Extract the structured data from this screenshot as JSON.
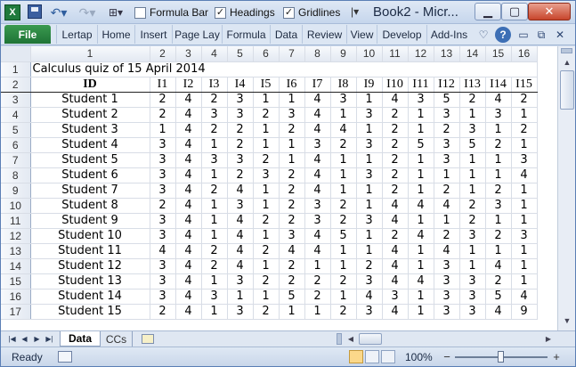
{
  "titlebar": {
    "app_icon": "excel-icon",
    "formula_bar_label": "Formula Bar",
    "formula_bar_checked": false,
    "headings_label": "Headings",
    "headings_checked": true,
    "gridlines_label": "Gridlines",
    "gridlines_checked": true,
    "document_title": "Book2 - Micr...",
    "icons": [
      "save-icon",
      "undo-icon",
      "redo-icon",
      "customize-icon",
      "minimize-icon",
      "maximize-icon",
      "close-icon"
    ]
  },
  "ribbon": {
    "file_label": "File",
    "tabs": [
      "Lertap",
      "Home",
      "Insert",
      "Page Lay",
      "Formula",
      "Data",
      "Review",
      "View",
      "Develop",
      "Add-Ins"
    ],
    "right_icons": [
      "heart-icon",
      "help-icon",
      "minimize-ribbon-icon",
      "restore-icon",
      "close-icon"
    ]
  },
  "sheet": {
    "column_headers": [
      "1",
      "2",
      "3",
      "4",
      "5",
      "6",
      "7",
      "8",
      "9",
      "10",
      "11",
      "12",
      "13",
      "14",
      "15",
      "16"
    ],
    "row_numbers": [
      "1",
      "2",
      "3",
      "4",
      "5",
      "6",
      "7",
      "8",
      "9",
      "10",
      "11",
      "12",
      "13",
      "14",
      "15",
      "16",
      "17"
    ],
    "title": "Calculus quiz of 15 April 2014",
    "id_header": "ID",
    "item_headers": [
      "I1",
      "I2",
      "I3",
      "I4",
      "I5",
      "I6",
      "I7",
      "I8",
      "I9",
      "I10",
      "I11",
      "I12",
      "I13",
      "I14",
      "I15"
    ],
    "students": [
      {
        "name": "Student 1",
        "scores": [
          "2",
          "4",
          "2",
          "3",
          "1",
          "1",
          "4",
          "3",
          "1",
          "4",
          "3",
          "5",
          "2",
          "4",
          "2"
        ]
      },
      {
        "name": "Student 2",
        "scores": [
          "2",
          "4",
          "3",
          "3",
          "2",
          "3",
          "4",
          "1",
          "3",
          "2",
          "1",
          "3",
          "1",
          "3",
          "1"
        ]
      },
      {
        "name": "Student 3",
        "scores": [
          "1",
          "4",
          "2",
          "2",
          "1",
          "2",
          "4",
          "4",
          "1",
          "2",
          "1",
          "2",
          "3",
          "1",
          "2"
        ]
      },
      {
        "name": "Student 4",
        "scores": [
          "3",
          "4",
          "1",
          "2",
          "1",
          "1",
          "3",
          "2",
          "3",
          "2",
          "5",
          "3",
          "5",
          "2",
          "1"
        ]
      },
      {
        "name": "Student 5",
        "scores": [
          "3",
          "4",
          "3",
          "3",
          "2",
          "1",
          "4",
          "1",
          "1",
          "2",
          "1",
          "3",
          "1",
          "1",
          "3"
        ]
      },
      {
        "name": "Student 6",
        "scores": [
          "3",
          "4",
          "1",
          "2",
          "3",
          "2",
          "4",
          "1",
          "3",
          "2",
          "1",
          "1",
          "1",
          "1",
          "4"
        ]
      },
      {
        "name": "Student 7",
        "scores": [
          "3",
          "4",
          "2",
          "4",
          "1",
          "2",
          "4",
          "1",
          "1",
          "2",
          "1",
          "2",
          "1",
          "2",
          "1"
        ]
      },
      {
        "name": "Student 8",
        "scores": [
          "2",
          "4",
          "1",
          "3",
          "1",
          "2",
          "3",
          "2",
          "1",
          "4",
          "4",
          "4",
          "2",
          "3",
          "1"
        ]
      },
      {
        "name": "Student 9",
        "scores": [
          "3",
          "4",
          "1",
          "4",
          "2",
          "2",
          "3",
          "2",
          "3",
          "4",
          "1",
          "1",
          "2",
          "1",
          "1"
        ]
      },
      {
        "name": "Student 10",
        "scores": [
          "3",
          "4",
          "1",
          "4",
          "1",
          "3",
          "4",
          "5",
          "1",
          "2",
          "4",
          "2",
          "3",
          "2",
          "3"
        ]
      },
      {
        "name": "Student 11",
        "scores": [
          "4",
          "4",
          "2",
          "4",
          "2",
          "4",
          "4",
          "1",
          "1",
          "4",
          "1",
          "4",
          "1",
          "1",
          "1"
        ]
      },
      {
        "name": "Student 12",
        "scores": [
          "3",
          "4",
          "2",
          "4",
          "1",
          "2",
          "1",
          "1",
          "2",
          "4",
          "1",
          "3",
          "1",
          "4",
          "1"
        ]
      },
      {
        "name": "Student 13",
        "scores": [
          "3",
          "4",
          "1",
          "3",
          "2",
          "2",
          "2",
          "2",
          "3",
          "4",
          "4",
          "3",
          "3",
          "2",
          "1"
        ]
      },
      {
        "name": "Student 14",
        "scores": [
          "3",
          "4",
          "3",
          "1",
          "1",
          "5",
          "2",
          "1",
          "4",
          "3",
          "1",
          "3",
          "3",
          "5",
          "4"
        ]
      },
      {
        "name": "Student 15",
        "scores": [
          "2",
          "4",
          "1",
          "3",
          "2",
          "1",
          "1",
          "2",
          "3",
          "4",
          "1",
          "3",
          "3",
          "4",
          "9"
        ]
      }
    ]
  },
  "sheet_tabs": {
    "active": "Data",
    "others": [
      "CCs"
    ],
    "nav_icons": [
      "first-sheet-icon",
      "prev-sheet-icon",
      "next-sheet-icon",
      "last-sheet-icon"
    ]
  },
  "status": {
    "ready_label": "Ready",
    "zoom_label": "100%",
    "zoom_minus": "−",
    "zoom_plus": "+",
    "zoom_fraction": 0.5
  }
}
